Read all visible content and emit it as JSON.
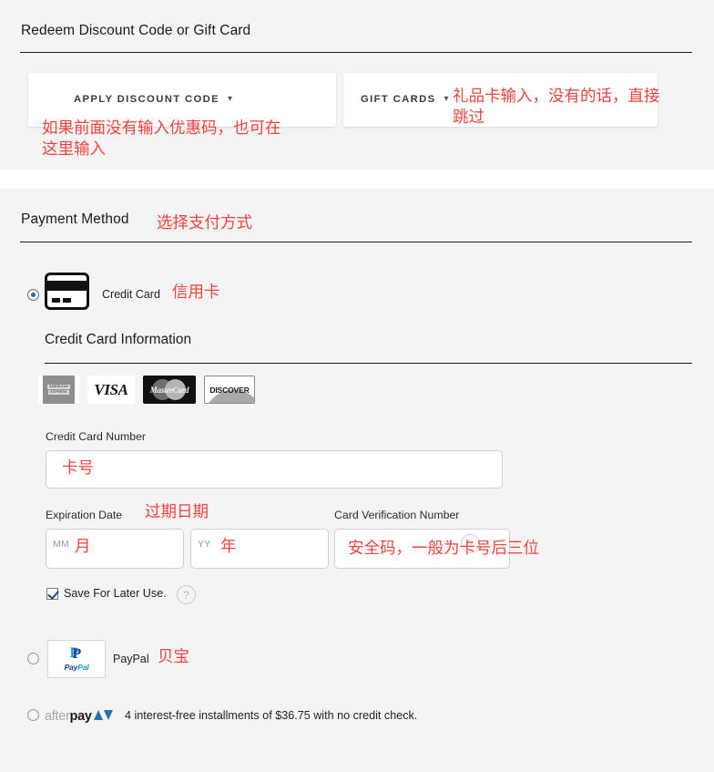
{
  "redeem": {
    "title": "Redeem Discount Code or Gift Card",
    "discount_card": {
      "label": "APPLY DISCOUNT CODE",
      "chevron": "chevron-down-icon"
    },
    "gift_card": {
      "label": "GIFT CARDS",
      "chevron": "chevron-down-icon"
    }
  },
  "payment": {
    "title": "Payment Method",
    "methods": [
      {
        "id": "credit-card",
        "label": "Credit Card",
        "selected": true
      },
      {
        "id": "paypal",
        "label": "PayPal",
        "selected": false
      },
      {
        "id": "afterpay",
        "label": "",
        "selected": false
      }
    ],
    "credit_card": {
      "section_title": "Credit Card Information",
      "accepted_brands": [
        {
          "name": "american-express",
          "text_line1": "AMERICAN",
          "text_line2": "EXPRESS"
        },
        {
          "name": "visa",
          "text": "VISA"
        },
        {
          "name": "mastercard",
          "text": "MasterCard"
        },
        {
          "name": "discover",
          "text": "DISCOVER"
        }
      ],
      "card_number_label": "Credit Card Number",
      "card_number_value": "",
      "expiration_label": "Expiration Date",
      "month_placeholder": "MM",
      "month_value": "",
      "year_placeholder": "YY",
      "year_value": "",
      "cvn_label": "Card Verification Number",
      "cvn_value": "",
      "cvn_help_icon": "question-mark-icon",
      "save_label": "Save For Later Use.",
      "save_checked": true,
      "save_help_icon": "question-mark-icon"
    },
    "paypal": {
      "label": "PayPal",
      "logo_word_a": "Pay",
      "logo_word_b": "Pal"
    },
    "afterpay": {
      "logo_light": "after",
      "logo_dark": "pay",
      "description": "4 interest-free installments of $36.75 with no credit check."
    }
  },
  "annotations": {
    "discount": "如果前面没有输入优惠码，也可在\n这里输入",
    "gift": "礼品卡输入，没有的话，直接\n跳过",
    "payment_method": "选择支付方式",
    "credit_card": "信用卡",
    "card_number": "卡号",
    "expiration": "过期日期",
    "month": "月",
    "year": "年",
    "cvn": "安全码，一般为卡号后三位",
    "paypal": "贝宝"
  },
  "colors": {
    "page_background": "#f4f4f4",
    "annotation_red": "#f4423c",
    "rule": "#1a1a1a",
    "radio_selected": "#2a6ea8",
    "paypal_dark_blue": "#1b3d87",
    "paypal_light_blue": "#189bd7",
    "afterpay_blue": "#2a6fb0"
  }
}
